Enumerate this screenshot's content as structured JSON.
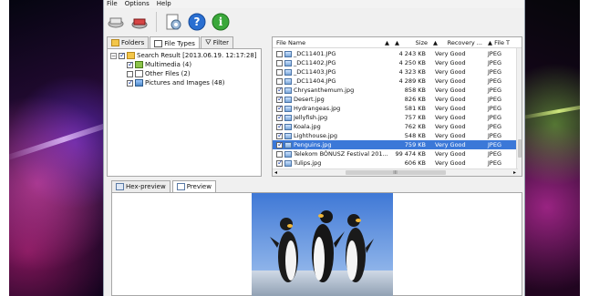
{
  "menu": [
    "File",
    "Options",
    "Help"
  ],
  "toolbar": {
    "icons": [
      "recover-icon",
      "recover-all-icon",
      "settings-icon",
      "help-icon",
      "info-icon"
    ]
  },
  "left_tabs": [
    "Folders",
    "File Types",
    "Filter"
  ],
  "tree": [
    {
      "label": "Search Result [2013.06.19. 12:17:28]",
      "level": 0,
      "checked": true
    },
    {
      "label": "Multimedia (4)",
      "level": 1,
      "checked": true
    },
    {
      "label": "Other Files (2)",
      "level": 1,
      "checked": false
    },
    {
      "label": "Pictures and Images (48)",
      "level": 1,
      "checked": true
    }
  ],
  "file_list": {
    "columns": [
      "File Name",
      "Size",
      "Recovery ...",
      "File T"
    ],
    "rows": [
      {
        "name": "_DC11401.JPG",
        "size": "4 243 KB",
        "recovery": "Very Good",
        "type": "JPEG",
        "checked": false
      },
      {
        "name": "_DC11402.JPG",
        "size": "4 250 KB",
        "recovery": "Very Good",
        "type": "JPEG",
        "checked": false
      },
      {
        "name": "_DC11403.JPG",
        "size": "4 323 KB",
        "recovery": "Very Good",
        "type": "JPEG",
        "checked": false
      },
      {
        "name": "_DC11404.JPG",
        "size": "4 289 KB",
        "recovery": "Very Good",
        "type": "JPEG",
        "checked": false
      },
      {
        "name": "Chrysanthemum.jpg",
        "size": "858 KB",
        "recovery": "Very Good",
        "type": "JPEG",
        "checked": true
      },
      {
        "name": "Desert.jpg",
        "size": "826 KB",
        "recovery": "Very Good",
        "type": "JPEG",
        "checked": true
      },
      {
        "name": "Hydrangeas.jpg",
        "size": "581 KB",
        "recovery": "Very Good",
        "type": "JPEG",
        "checked": true
      },
      {
        "name": "Jellyfish.jpg",
        "size": "757 KB",
        "recovery": "Very Good",
        "type": "JPEG",
        "checked": true
      },
      {
        "name": "Koala.jpg",
        "size": "762 KB",
        "recovery": "Very Good",
        "type": "JPEG",
        "checked": true
      },
      {
        "name": "Lighthouse.jpg",
        "size": "548 KB",
        "recovery": "Very Good",
        "type": "JPEG",
        "checked": true
      },
      {
        "name": "Penguins.jpg",
        "size": "759 KB",
        "recovery": "Very Good",
        "type": "JPEG",
        "checked": true,
        "selected": true
      },
      {
        "name": "Telekom BÓNUSZ Festival 201...",
        "size": "99 474 KB",
        "recovery": "Very Good",
        "type": "JPEG",
        "checked": false
      },
      {
        "name": "Tulips.jpg",
        "size": "606 KB",
        "recovery": "Very Good",
        "type": "JPEG",
        "checked": true
      }
    ],
    "hscroll_grip": "III"
  },
  "bottom_tabs": [
    "Hex-preview",
    "Preview"
  ],
  "colors": {
    "selection": "#3b78d8",
    "accent": "#2a6fd1"
  }
}
